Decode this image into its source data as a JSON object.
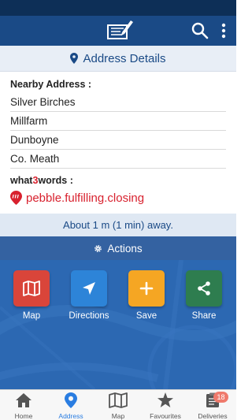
{
  "colors": {
    "appbar": "#1a4a86",
    "statusbar": "#0d2f57",
    "accent_blue": "#1a4a86",
    "w3w_red": "#d8212e",
    "map_tile": "#d9453a",
    "directions_tile": "#2d84d8",
    "save_tile": "#f5a623",
    "share_tile": "#2e7d4f",
    "nav_active": "#2a7de1"
  },
  "header": {
    "icons": [
      "app-logo-icon",
      "search-icon",
      "overflow-menu-icon"
    ]
  },
  "address_details": {
    "title": "Address Details",
    "nearby_label": "Nearby Address :",
    "lines": [
      "Silver Birches",
      "Millfarm",
      "Dunboyne",
      "Co. Meath"
    ],
    "w3w_label_prefix": "what",
    "w3w_label_three": "3",
    "w3w_label_suffix": "words :",
    "w3w_value": "pebble.fulfilling.closing"
  },
  "distance_text": "About 1 m (1 min) away.",
  "actions": {
    "title": "Actions",
    "items": [
      {
        "label": "Map",
        "icon": "map-icon"
      },
      {
        "label": "Directions",
        "icon": "navigation-arrow-icon"
      },
      {
        "label": "Save",
        "icon": "plus-icon"
      },
      {
        "label": "Share",
        "icon": "share-icon"
      }
    ]
  },
  "bottom_nav": {
    "items": [
      {
        "label": "Home",
        "icon": "home-icon",
        "active": false
      },
      {
        "label": "Address",
        "icon": "location-pin-icon",
        "active": true
      },
      {
        "label": "Map",
        "icon": "map-icon",
        "active": false
      },
      {
        "label": "Favourites",
        "icon": "star-icon",
        "active": false
      },
      {
        "label": "Deliveries",
        "icon": "clipboard-icon",
        "active": false
      }
    ],
    "deliveries_badge": "18"
  }
}
